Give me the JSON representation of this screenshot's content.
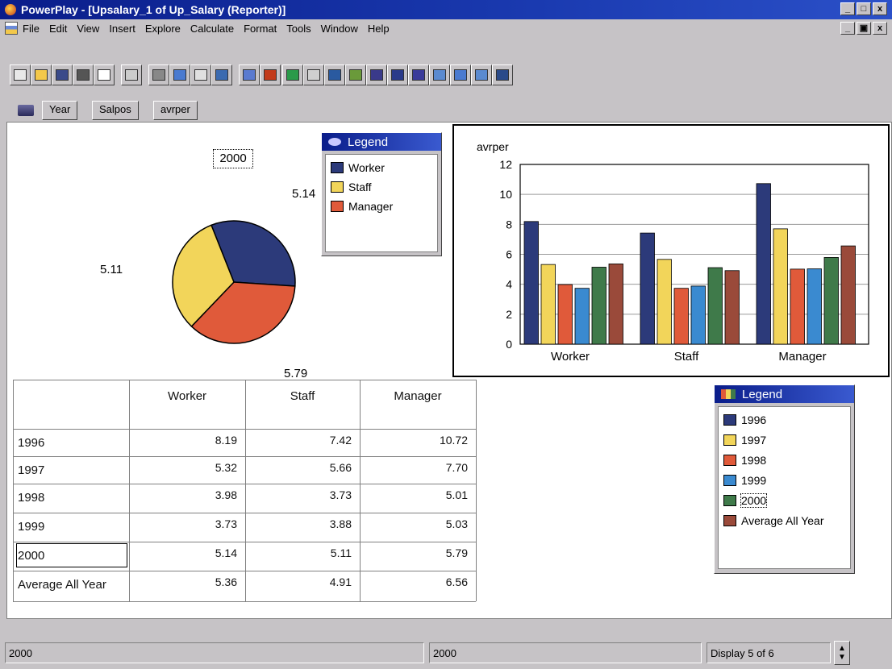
{
  "window": {
    "title": "PowerPlay - [Upsalary_1 of Up_Salary (Reporter)]",
    "controls": {
      "minimize": "_",
      "restore": "□",
      "close": "x"
    },
    "mdi_controls": {
      "minimize": "_",
      "restore": "▣",
      "close": "x"
    }
  },
  "menu": {
    "items": [
      "File",
      "Edit",
      "View",
      "Insert",
      "Explore",
      "Calculate",
      "Format",
      "Tools",
      "Window",
      "Help"
    ]
  },
  "toolbar": {
    "icons": [
      "new-icon",
      "open-icon",
      "save-icon",
      "print-icon",
      "print-preview-icon",
      "undo-icon",
      "drill-up-icon",
      "swap-icon",
      "add-icon",
      "zoom-icon",
      "sort-icon",
      "rank-icon",
      "find-icon",
      "crosstab-icon",
      "pie-icon",
      "3d-bar-icon",
      "bar-icon",
      "clustered-bar-icon",
      "stacked-bar-icon",
      "line-icon",
      "area-icon",
      "scatter-icon",
      "correlation-icon"
    ]
  },
  "dimension_bar": {
    "tabs": [
      "Year",
      "Salpos",
      "avrper"
    ]
  },
  "pie": {
    "title": "2000",
    "labels": {
      "worker": "5.14",
      "staff": "5.11",
      "manager": "5.79"
    }
  },
  "legend_top": {
    "title": "Legend",
    "items": [
      {
        "label": "Worker",
        "color": "#2c3a7a"
      },
      {
        "label": "Staff",
        "color": "#f2d55a"
      },
      {
        "label": "Manager",
        "color": "#e05a3a"
      }
    ]
  },
  "legend_bottom": {
    "title": "Legend",
    "items": [
      {
        "label": "1996",
        "color": "#2c3a7a"
      },
      {
        "label": "1997",
        "color": "#f2d55a"
      },
      {
        "label": "1998",
        "color": "#e05a3a"
      },
      {
        "label": "1999",
        "color": "#3a8ad0"
      },
      {
        "label": "2000",
        "color": "#3f7a4a"
      },
      {
        "label": "Average All Year",
        "color": "#9a4a3a"
      }
    ]
  },
  "crosstab": {
    "columns": [
      "Worker",
      "Staff",
      "Manager"
    ],
    "rows": [
      {
        "label": "1996",
        "values": [
          "8.19",
          "7.42",
          "10.72"
        ]
      },
      {
        "label": "1997",
        "values": [
          "5.32",
          "5.66",
          "7.70"
        ]
      },
      {
        "label": "1998",
        "values": [
          "3.98",
          "3.73",
          "5.01"
        ]
      },
      {
        "label": "1999",
        "values": [
          "3.73",
          "3.88",
          "5.03"
        ]
      },
      {
        "label": "2000",
        "values": [
          "5.14",
          "5.11",
          "5.79"
        ]
      },
      {
        "label": "Average All Year",
        "values": [
          "5.36",
          "4.91",
          "6.56"
        ]
      }
    ]
  },
  "status": {
    "left": "2000",
    "middle": "2000",
    "right": "Display 5 of 6"
  },
  "chart_data": [
    {
      "type": "bar",
      "ylabel": "avrper",
      "ylim": [
        0,
        12
      ],
      "yticks": [
        "0",
        "2",
        "4",
        "6",
        "8",
        "10",
        "12"
      ],
      "categories": [
        "Worker",
        "Staff",
        "Manager"
      ],
      "series": [
        {
          "name": "1996",
          "values": [
            8.19,
            7.42,
            10.72
          ],
          "color": "#2c3a7a"
        },
        {
          "name": "1997",
          "values": [
            5.32,
            5.66,
            7.7
          ],
          "color": "#f2d55a"
        },
        {
          "name": "1998",
          "values": [
            3.98,
            3.73,
            5.01
          ],
          "color": "#e05a3a"
        },
        {
          "name": "1999",
          "values": [
            3.73,
            3.88,
            5.03
          ],
          "color": "#3a8ad0"
        },
        {
          "name": "2000",
          "values": [
            5.14,
            5.11,
            5.79
          ],
          "color": "#3f7a4a"
        },
        {
          "name": "Average All Year",
          "values": [
            5.36,
            4.91,
            6.56
          ],
          "color": "#9a4a3a"
        }
      ],
      "grid": true
    },
    {
      "type": "pie",
      "title": "2000",
      "categories": [
        "Worker",
        "Staff",
        "Manager"
      ],
      "values": [
        5.14,
        5.11,
        5.79
      ],
      "colors": [
        "#2c3a7a",
        "#f2d55a",
        "#e05a3a"
      ]
    }
  ]
}
